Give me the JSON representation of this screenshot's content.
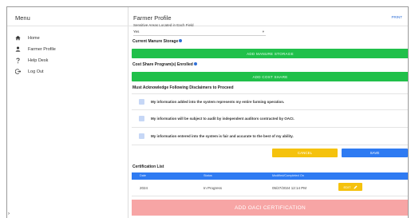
{
  "sidebar": {
    "title": "Menu",
    "items": [
      {
        "label": "Home",
        "icon": "home-icon"
      },
      {
        "label": "Farmer Profile",
        "icon": "user-icon"
      },
      {
        "label": "Help Desk",
        "icon": "help-icon"
      },
      {
        "label": "Log Out",
        "icon": "logout-icon"
      }
    ]
  },
  "header": {
    "title": "Farmer Profile",
    "link_label": "PRINT"
  },
  "form": {
    "cutoff_label": "Sensitive Areas Located in Each Field",
    "sensitive_value": "Yes",
    "manure_label": "Current Manure Storage",
    "add_manure_label": "ADD MANURE STORAGE",
    "cost_share_label": "Cost Share Program(s) Enrolled",
    "add_cost_share_label": "ADD COST SHARE",
    "disclaimer_heading": "Must Acknowledge Following Disclaimers to Proceed",
    "disclaimers": [
      "My information added into the system represents my entire farming operation.",
      "My information will be subject to audit by independent auditors contracted by OACI.",
      "My information entered into the system is fair and accurate to the best of my ability."
    ],
    "cancel_label": "CANCEL",
    "save_label": "SAVE"
  },
  "certification": {
    "title": "Certification List",
    "columns": [
      "Date",
      "Status",
      "Modified/Completed On"
    ],
    "rows": [
      {
        "date": "2024",
        "status": "In Progress",
        "modified": "05/27/2024 12:14 PM",
        "action": "EDIT"
      }
    ],
    "add_label": "ADD OACI CERTIFICATION"
  },
  "colors": {
    "accent_blue": "#2f7bf2",
    "success_green": "#20c04a",
    "warning_yellow": "#f5c20d",
    "disabled_red": "#f7a5a5"
  }
}
